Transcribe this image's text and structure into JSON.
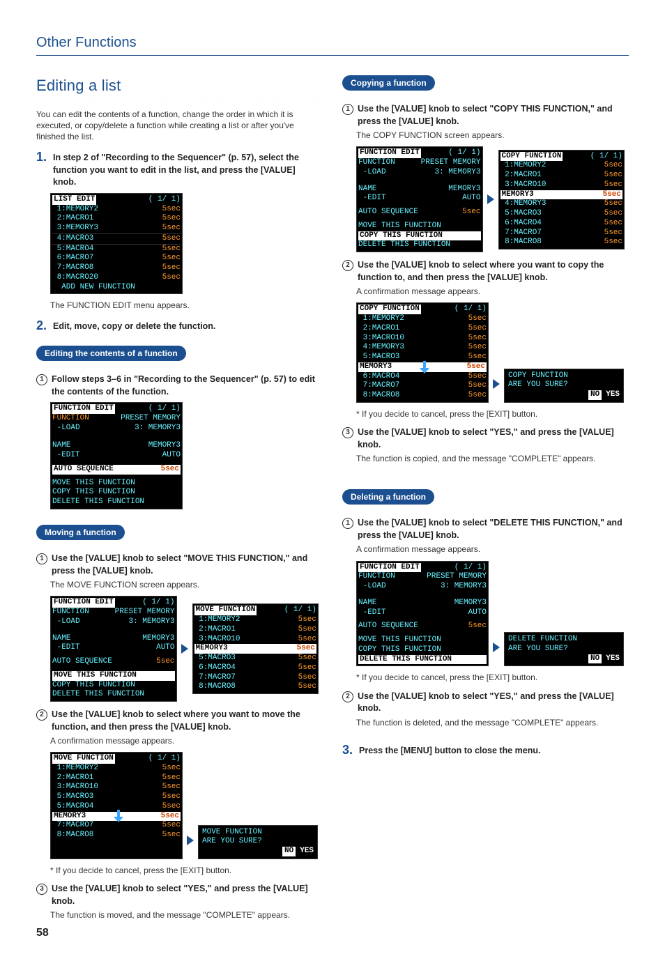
{
  "header": {
    "breadcrumb": "Other Functions"
  },
  "page_number": "58",
  "left": {
    "title": "Editing a list",
    "intro": "You can edit the contents of a function, change the order in which it is executed, or copy/delete a function while creating a list or after you've finished the list.",
    "step1": "In step 2 of \"Recording to the Sequencer\" (p. 57), select the function you want to edit in the list, and press the [VALUE] knob.",
    "step1_result": "The FUNCTION EDIT menu appears.",
    "step2": "Edit, move, copy or delete the function.",
    "subsec_edit": {
      "pill": "Editing the contents of a function",
      "s1": "Follow steps 3–6 in \"Recording to the Sequencer\" (p. 57) to edit the contents of the function."
    },
    "subsec_move": {
      "pill": "Moving a function",
      "s1": "Use the [VALUE] knob to select \"MOVE THIS FUNCTION,\" and press the [VALUE] knob.",
      "r1": "The MOVE FUNCTION screen appears.",
      "s2": "Use the [VALUE] knob to select where you want to move the function, and then press the [VALUE] knob.",
      "r2": "A confirmation message appears.",
      "note2": "* If you decide to cancel, press the [EXIT] button.",
      "s3": "Use the [VALUE] knob to select \"YES,\" and press the [VALUE] knob.",
      "r3": "The function is moved, and the message \"COMPLETE\" appears."
    }
  },
  "right": {
    "subsec_copy": {
      "pill": "Copying a function",
      "s1": "Use the [VALUE] knob to select \"COPY THIS FUNCTION,\" and press the [VALUE] knob.",
      "r1": "The COPY FUNCTION screen appears.",
      "s2": "Use the [VALUE] knob to select where you want to copy the function to, and then press the [VALUE] knob.",
      "r2": "A confirmation message appears.",
      "note2": "* If you decide to cancel, press the [EXIT] button.",
      "s3": "Use the [VALUE] knob to select \"YES,\" and press the [VALUE] knob.",
      "r3": "The function is copied, and the message \"COMPLETE\" appears."
    },
    "subsec_delete": {
      "pill": "Deleting a function",
      "s1": "Use the [VALUE] knob to select \"DELETE THIS FUNCTION,\" and press the [VALUE] knob.",
      "r1": "A confirmation message appears.",
      "note1": "* If you decide to cancel, press the [EXIT] button.",
      "s2": "Use the [VALUE] knob to select \"YES,\" and press the [VALUE] knob.",
      "r2": "The function is deleted, and the message \"COMPLETE\" appears."
    },
    "step3": "Press the [MENU] button to close the menu."
  },
  "lcd": {
    "list_edit": {
      "title": "LIST EDIT",
      "page": "( 1/ 1)",
      "rows": [
        [
          " 1:MEMORY2",
          "5sec"
        ],
        [
          " 2:MACRO1",
          "5sec"
        ],
        [
          " 3:MEMORY3",
          "5sec"
        ],
        [
          " 4:MACRO3",
          "5sec"
        ],
        [
          " 5:MACRO4",
          "5sec"
        ],
        [
          " 6:MACRO7",
          "5sec"
        ],
        [
          " 7:MACRO8",
          "5sec"
        ],
        [
          " 8:MACRO20",
          "5sec"
        ]
      ],
      "add": "  ADD NEW FUNCTION"
    },
    "func_edit": {
      "title": "FUNCTION EDIT",
      "page": "( 1/ 1)",
      "function_lbl": "FUNCTION",
      "function_val": "PRESET MEMORY",
      "load_lbl": " -LOAD",
      "load_val": "3: MEMORY3",
      "name_lbl": "NAME",
      "name_val": "MEMORY3",
      "edit_lbl": " -EDIT",
      "edit_val": "AUTO",
      "auto_lbl": "AUTO SEQUENCE",
      "auto_val": "5sec",
      "menu": [
        "MOVE THIS FUNCTION",
        "COPY THIS FUNCTION",
        "DELETE THIS FUNCTION"
      ]
    },
    "move_dest": {
      "title": "MOVE FUNCTION",
      "page": "( 1/ 1)",
      "rows": [
        [
          " 1:MEMORY2",
          "5sec"
        ],
        [
          " 2:MACRO1",
          "5sec"
        ],
        [
          " 3:MACRO10",
          "5sec"
        ],
        [
          "MEMORY3",
          "5sec"
        ],
        [
          " 5:MACRO3",
          "5sec"
        ],
        [
          " 6:MACRO4",
          "5sec"
        ],
        [
          " 7:MACRO7",
          "5sec"
        ],
        [
          " 8:MACRO8",
          "5sec"
        ]
      ]
    },
    "move_confirm": {
      "title": "MOVE FUNCTION",
      "page": "( 1/ 1)",
      "rows_top": [
        [
          " 1:MEMORY2",
          "5sec"
        ],
        [
          " 2:MACRO1",
          "5sec"
        ],
        [
          " 3:MACRO10",
          "5sec"
        ],
        [
          " 5:MACRO3",
          "5sec"
        ],
        [
          " 5:MACRO4",
          "5sec"
        ]
      ],
      "highlight": [
        "MEMORY3",
        "5sec"
      ],
      "rows_bot": [
        [
          " 7:MACRO7",
          "5sec"
        ],
        [
          " 8:MACRO8",
          "5sec"
        ]
      ],
      "dialog": {
        "title": "MOVE FUNCTION",
        "msg": "ARE YOU SURE?",
        "no": "NO",
        "yes": "YES"
      }
    },
    "copy_dest": {
      "title": "COPY FUNCTION",
      "page": "( 1/ 1)",
      "rows_top": [
        [
          " 1:MEMORY2",
          "5sec"
        ],
        [
          " 2:MACRO1",
          "5sec"
        ],
        [
          " 3:MACRO10",
          "5sec"
        ]
      ],
      "highlight": [
        "MEMORY3",
        "5sec"
      ],
      "rows_bot": [
        [
          " 4:MEMORY3",
          "5sec"
        ],
        [
          " 5:MACRO3",
          "5sec"
        ],
        [
          " 6:MACRO4",
          "5sec"
        ],
        [
          " 7:MACRO7",
          "5sec"
        ],
        [
          " 8:MACRO8",
          "5sec"
        ]
      ]
    },
    "copy_confirm": {
      "title": "COPY FUNCTION",
      "page": "( 1/ 1)",
      "rows_top": [
        [
          " 1:MEMORY2",
          "5sec"
        ],
        [
          " 2:MACRO1",
          "5sec"
        ],
        [
          " 3:MACRO10",
          "5sec"
        ],
        [
          " 4:MEMORY3",
          "5sec"
        ],
        [
          " 5:MACRO3",
          "5sec"
        ]
      ],
      "highlight": [
        "MEMORY3",
        "5sec"
      ],
      "rows_bot": [
        [
          " 6:MACRO4",
          "5sec"
        ],
        [
          " 7:MACRO7",
          "5sec"
        ],
        [
          " 8:MACRO8",
          "5sec"
        ]
      ],
      "dialog": {
        "title": "COPY FUNCTION",
        "msg": "ARE YOU SURE?",
        "no": "NO",
        "yes": "YES"
      }
    },
    "delete_confirm": {
      "dialog": {
        "title": "DELETE FUNCTION",
        "msg": "ARE YOU SURE?",
        "no": "NO",
        "yes": "YES"
      }
    }
  }
}
